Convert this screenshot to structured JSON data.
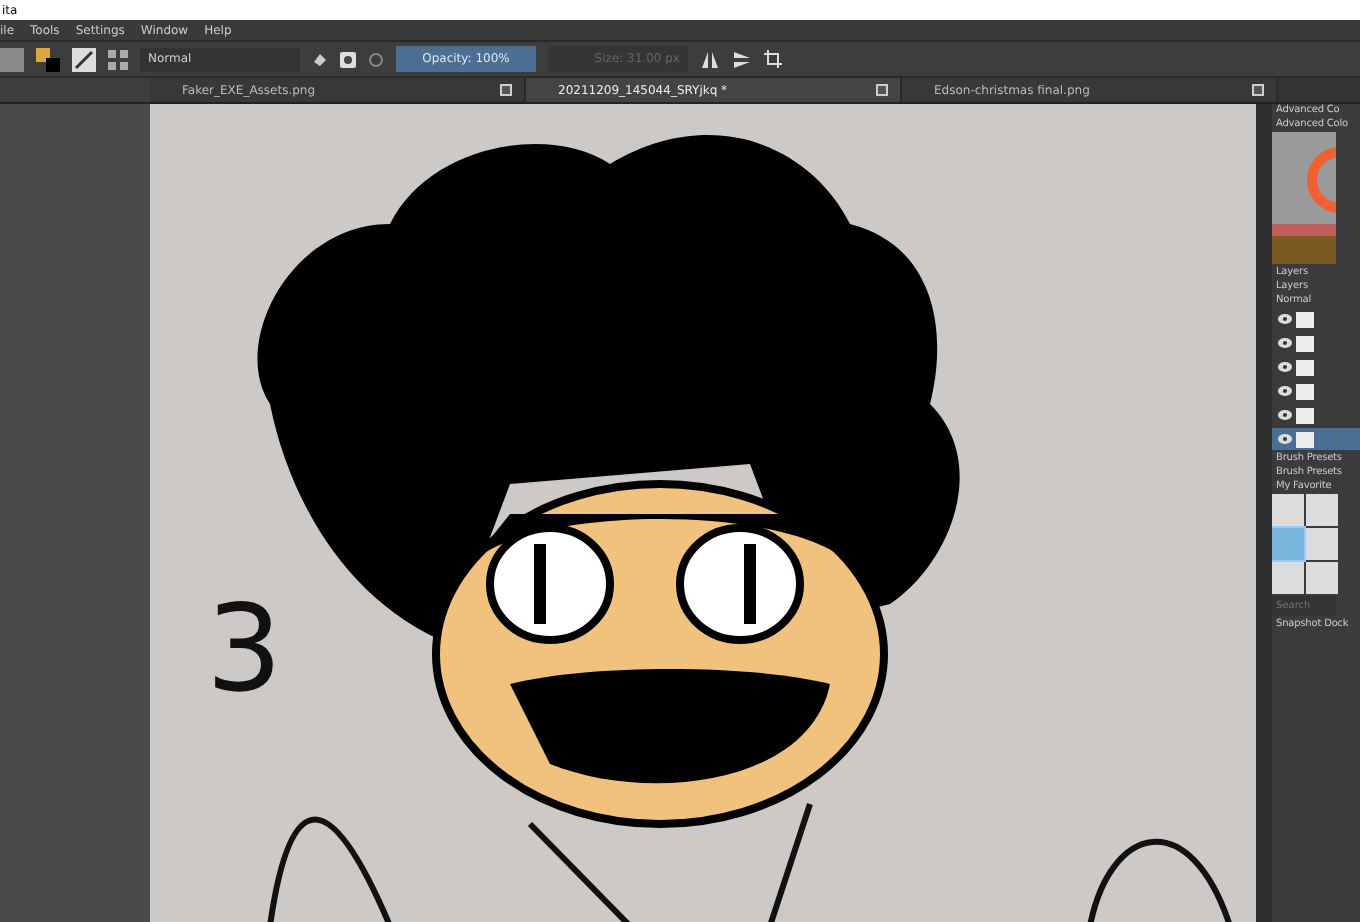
{
  "window": {
    "title": "ita"
  },
  "menu": [
    "ile",
    "Tools",
    "Settings",
    "Window",
    "Help"
  ],
  "toolbar": {
    "blend_mode": "Normal",
    "opacity": {
      "label": "Opacity: 100%",
      "level": 1
    },
    "size": {
      "label": "Size: 31.00 px",
      "disabled": true
    }
  },
  "tabs": [
    {
      "label": "Faker_EXE_Assets.png",
      "selected": false
    },
    {
      "label": "20211209_145044_SRYjkq *",
      "selected": true
    },
    {
      "label": "Edson-christmas final.png",
      "selected": false
    }
  ],
  "canvas": {
    "mark": "3"
  },
  "docker": {
    "titles": [
      "Advanced Co",
      "Advanced Colo"
    ],
    "layers_tab": "Layers",
    "layers_title": "Layers",
    "layers_blend": "Normal",
    "layers": [
      {
        "selected": false
      },
      {
        "selected": false
      },
      {
        "selected": false
      },
      {
        "selected": false
      },
      {
        "selected": false
      },
      {
        "selected": true
      }
    ],
    "brush_tab": "Brush Presets",
    "brush_title": "Brush Presets",
    "favorites": "My Favorite",
    "presets": [
      {
        "selected": false
      },
      {
        "selected": false
      },
      {
        "selected": true
      },
      {
        "selected": false
      },
      {
        "selected": false
      },
      {
        "selected": false
      }
    ],
    "search": {
      "placeholder": "Search"
    },
    "snapshot": "Snapshot Dock"
  }
}
